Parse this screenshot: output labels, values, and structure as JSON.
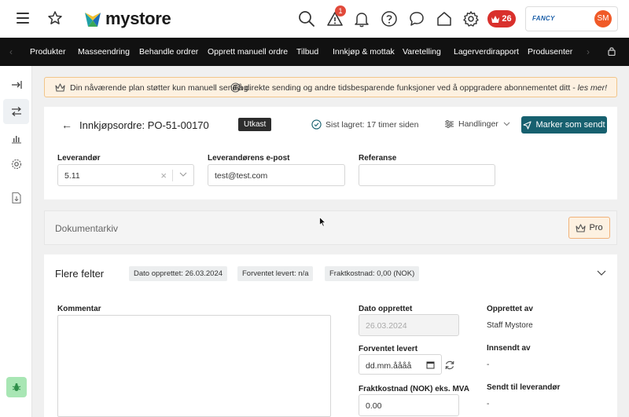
{
  "header": {
    "logo_text": "mystore",
    "notification_count": "1",
    "credits_count": "26",
    "company_logo_text": "FANCY",
    "avatar_initials": "SM"
  },
  "nav": {
    "items": [
      "Produkter",
      "Masseendring",
      "Behandle ordrer",
      "Opprett manuell ordre",
      "Tilbud",
      "Innkjøp & mottak",
      "Varetelling",
      "Lagerverdirapport",
      "Produsenter"
    ]
  },
  "banner": {
    "left_text": "Din nåværende plan støtter kun manuell sending",
    "right_text": "Få direkte sending og andre tidsbesparende funksjoner ved å oppgradere abonnementet ditt - ",
    "right_link": "les mer!"
  },
  "order": {
    "title": "Innkjøpsordre:  PO-51-00170",
    "status": "Utkast",
    "saved": "Sist lagret: 17 timer siden",
    "actions_label": "Handlinger",
    "primary_button": "Marker som sendt"
  },
  "fields": {
    "supplier_label": "Leverandør",
    "supplier_value": "5.11",
    "email_label": "Leverandørens e-post",
    "email_value": "test@test.com",
    "reference_label": "Referanse",
    "reference_value": ""
  },
  "docs": {
    "title": "Dokumentarkiv",
    "pro_label": "Pro"
  },
  "more": {
    "title": "Flere felter",
    "chips": [
      "Dato opprettet: 26.03.2024",
      "Forventet levert: n/a",
      "Fraktkostnad: 0,00 (NOK)"
    ],
    "comment_label": "Kommentar",
    "date_created_label": "Dato opprettet",
    "date_created_value": "26.03.2024",
    "expected_label": "Forventet levert",
    "expected_placeholder": "dd.mm.åååå",
    "freight_label": "Fraktkostnad (NOK) eks. MVA",
    "freight_value": "0.00",
    "created_by_label": "Opprettet av",
    "created_by_value": "Staff Mystore",
    "submitted_by_label": "Innsendt av",
    "submitted_by_value": "-",
    "sent_label": "Sendt til leverandør",
    "sent_value": "-"
  },
  "colors": {
    "primary": "#17606f",
    "nav_bg": "#111111",
    "banner_bg": "#fdf1e1",
    "badge_red": "#d9302c",
    "avatar": "#f05a28"
  }
}
